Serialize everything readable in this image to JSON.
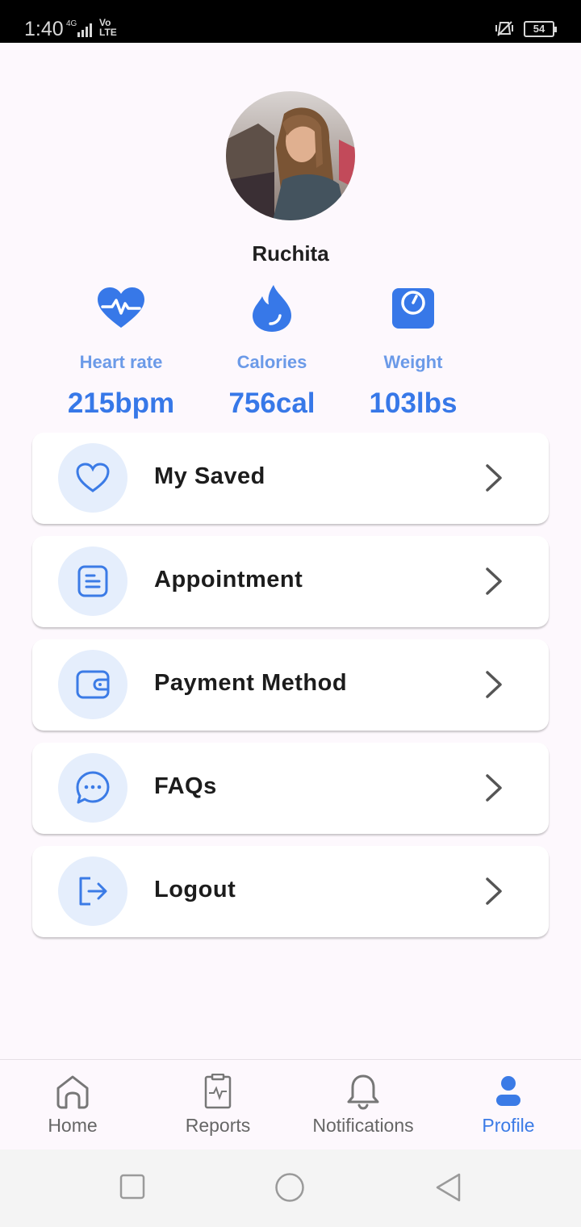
{
  "status_bar": {
    "time": "1:40",
    "network": "4G",
    "volte": "Vo\nLTE",
    "battery": "54"
  },
  "profile": {
    "name": "Ruchita",
    "avatar_alt": "Profile photo"
  },
  "stats": [
    {
      "label": "Heart rate",
      "value": "215bpm",
      "icon": "heart-pulse-icon"
    },
    {
      "label": "Calories",
      "value": "756cal",
      "icon": "flame-icon"
    },
    {
      "label": "Weight",
      "value": "103lbs",
      "icon": "scale-icon"
    }
  ],
  "menu": [
    {
      "label": "My Saved",
      "icon": "heart-icon"
    },
    {
      "label": "Appointment",
      "icon": "document-icon"
    },
    {
      "label": "Payment Method",
      "icon": "wallet-icon"
    },
    {
      "label": "FAQs",
      "icon": "chat-icon"
    },
    {
      "label": "Logout",
      "icon": "logout-icon"
    }
  ],
  "bottom_nav": [
    {
      "label": "Home",
      "icon": "home-icon",
      "active": false
    },
    {
      "label": "Reports",
      "icon": "report-icon",
      "active": false
    },
    {
      "label": "Notifications",
      "icon": "bell-icon",
      "active": false
    },
    {
      "label": "Profile",
      "icon": "person-icon",
      "active": true
    }
  ],
  "colors": {
    "accent": "#3b7be6",
    "stat_label": "#6b9ae8",
    "icon_bg": "#e5eefc"
  }
}
